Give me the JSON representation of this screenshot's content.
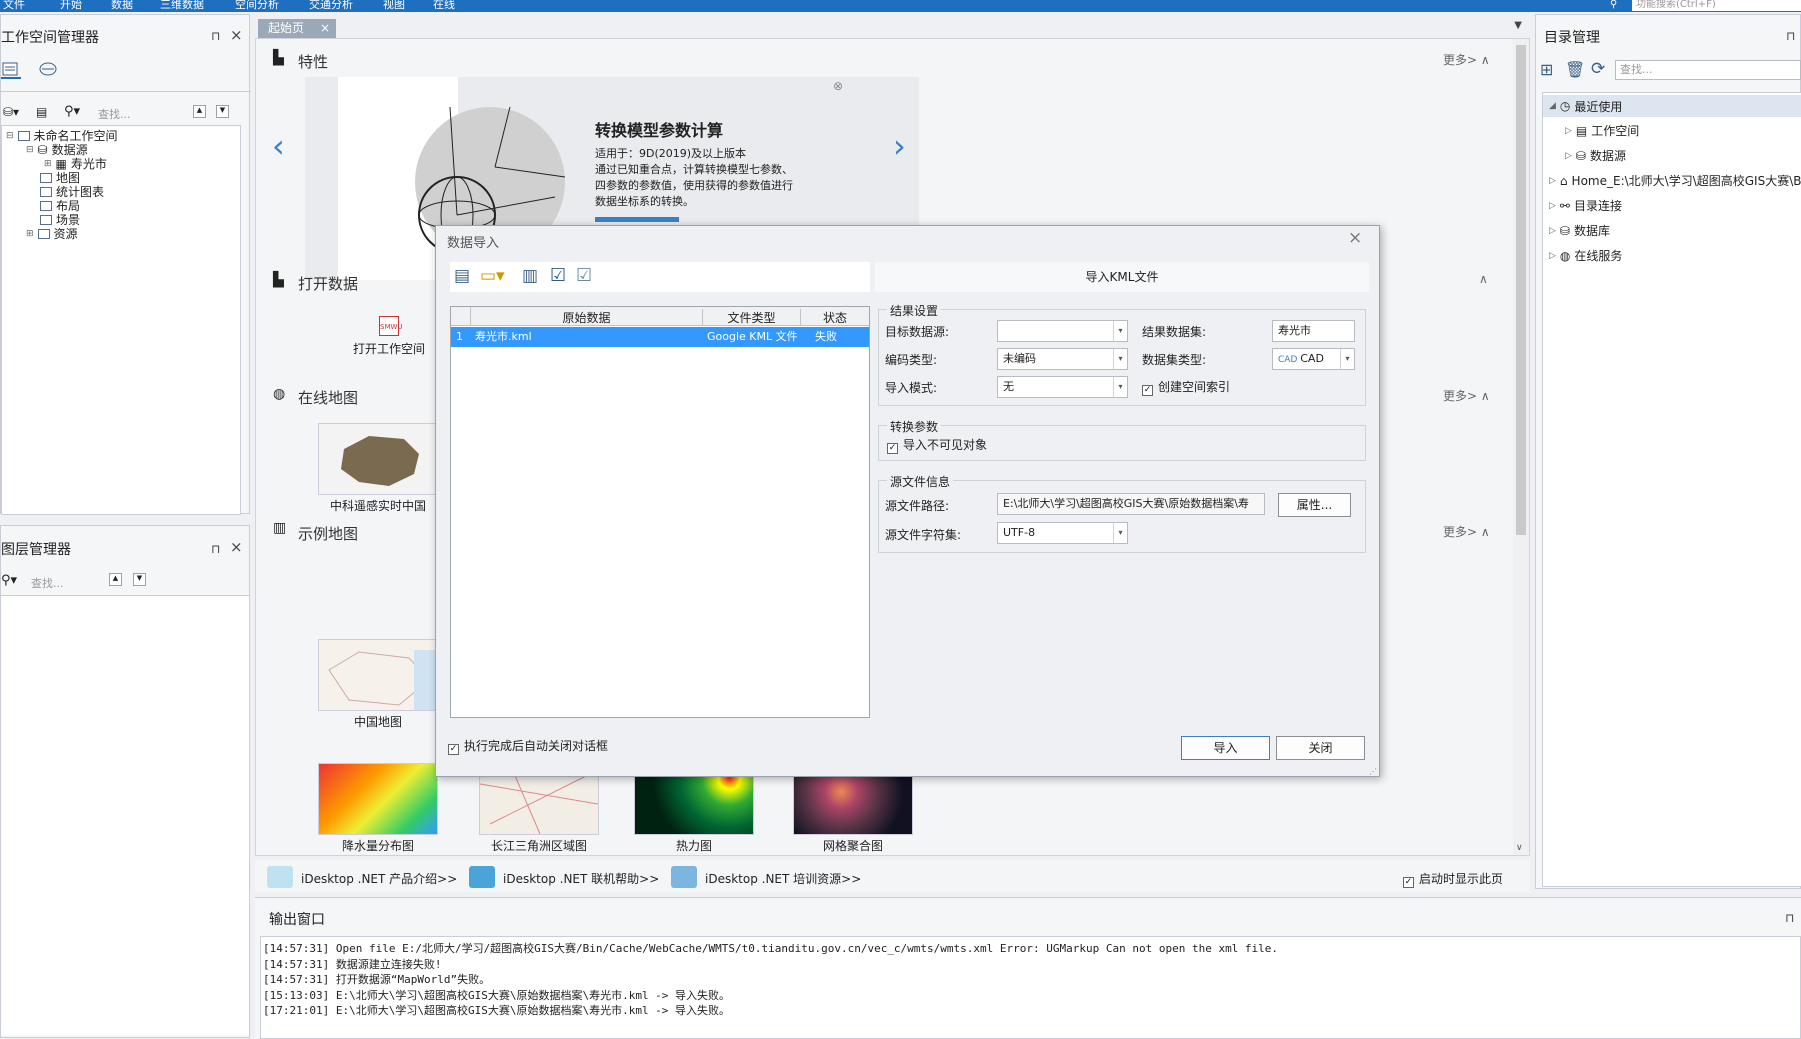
{
  "menu": {
    "items": [
      "文件",
      "开始",
      "数据",
      "三维数据",
      "空间分析",
      "交通分析",
      "视图",
      "在线"
    ],
    "search_placeholder": "功能搜索(Ctrl+F)"
  },
  "workspace_panel": {
    "title": "工作空间管理器",
    "search_placeholder": "查找...",
    "tree": [
      "未命名工作空间",
      "数据源",
      "寿光市",
      "地图",
      "统计图表",
      "布局",
      "场景",
      "资源"
    ]
  },
  "layer_panel": {
    "title": "图层管理器",
    "search_placeholder": "查找..."
  },
  "tabs": {
    "start": "起始页"
  },
  "start": {
    "feature_title": "特性",
    "more": "更多>",
    "banner": {
      "title": "转换模型参数计算",
      "applies": "适用于：9D(2019)及以上版本",
      "desc1": "通过已知重合点，计算转换模型七参数、",
      "desc2": "四参数的参数值，使用获得的参数值进行",
      "desc3": "数据坐标系的转换。"
    },
    "open_title": "打开数据",
    "open_ws": "打开工作空间",
    "online_title": "在线地图",
    "online_card": "中科遥感实时中国",
    "sample_title": "示例地图",
    "samples": [
      "中国地图",
      "降水量分布图",
      "长江三角洲区域图",
      "热力图",
      "网格聚合图"
    ],
    "footer_links": [
      "iDesktop .NET 产品介绍>>",
      "iDesktop .NET 联机帮助>>",
      "iDesktop .NET 培训资源>>"
    ],
    "show_on_start": "启动时显示此页"
  },
  "dialog": {
    "title": "数据导入",
    "right_header": "导入KML文件",
    "table": {
      "headers": [
        "原始数据",
        "文件类型",
        "状态"
      ],
      "rows": [
        {
          "num": "1",
          "name": "寿光市.kml",
          "type": "Google KML 文件",
          "status": "失败"
        }
      ]
    },
    "result_group": "结果设置",
    "target_ds_label": "目标数据源:",
    "target_ds_value": "",
    "result_set_label": "结果数据集:",
    "result_set_value": "寿光市",
    "encoding_label": "编码类型:",
    "encoding_value": "未编码",
    "dstype_label": "数据集类型:",
    "dstype_value": "CAD",
    "mode_label": "导入模式:",
    "mode_value": "无",
    "spatial_index": "创建空间索引",
    "convert_group": "转换参数",
    "import_invisible": "导入不可见对象",
    "source_group": "源文件信息",
    "path_label": "源文件路径:",
    "path_value": "E:\\北师大\\学习\\超图高校GIS大赛\\原始数据档案\\寿",
    "props_btn": "属性...",
    "charset_label": "源文件字符集:",
    "charset_value": "UTF-8",
    "auto_close": "执行完成后自动关闭对话框",
    "import_btn": "导入",
    "close_btn": "关闭"
  },
  "catalog": {
    "title": "目录管理",
    "search_placeholder": "查找...",
    "items": [
      "最近使用",
      "工作空间",
      "数据源",
      "Home_E:\\北师大\\学习\\超图高校GIS大赛\\Bi",
      "目录连接",
      "数据库",
      "在线服务"
    ]
  },
  "output": {
    "title": "输出窗口",
    "lines": [
      "[14:57:31] Open file E:/北师大/学习/超图高校GIS大赛/Bin/Cache/WebCache/WMTS/t0.tianditu.gov.cn/vec_c/wmts/wmts.xml Error: UGMarkup Can not open the xml file.",
      "[14:57:31] 数据源建立连接失败!",
      "[14:57:31] 打开数据源“MapWorld”失败。",
      "[15:13:03] E:\\北师大\\学习\\超图高校GIS大赛\\原始数据档案\\寿光市.kml     -> 导入失败。",
      "[17:21:01] E:\\北师大\\学习\\超图高校GIS大赛\\原始数据档案\\寿光市.kml     -> 导入失败。"
    ]
  },
  "colors": {
    "accent": "#1e6fc0",
    "selected_row": "#3399ff"
  }
}
